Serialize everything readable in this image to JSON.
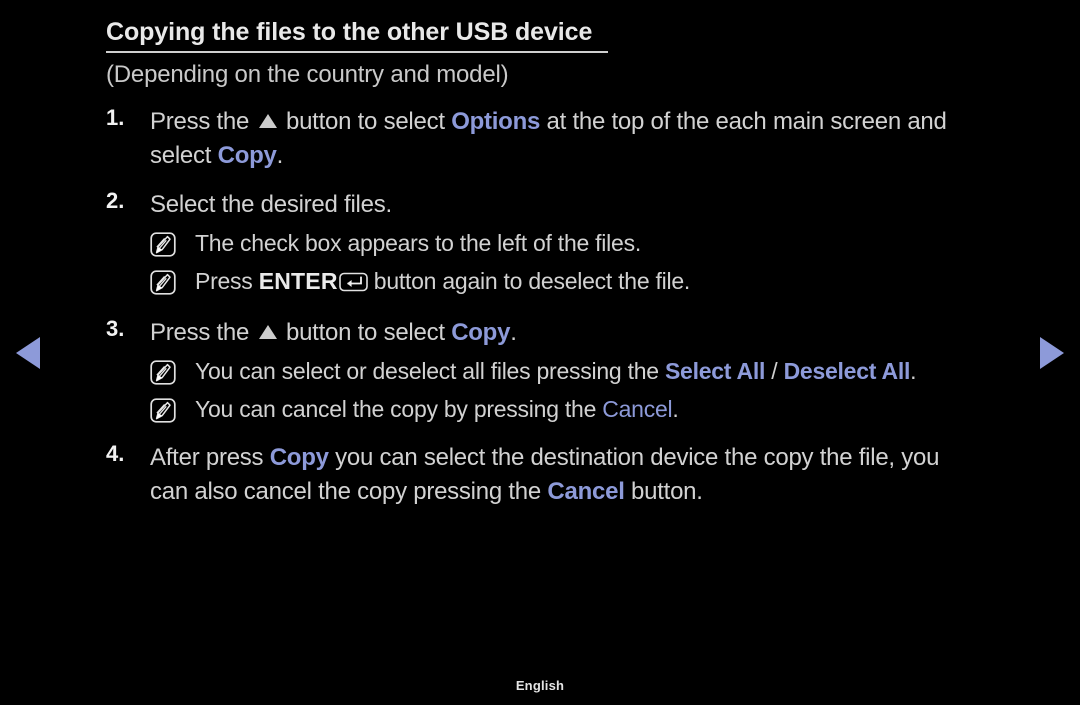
{
  "page": {
    "title": "Copying the files to the other USB device",
    "subtitle": "(Depending on the country and model)",
    "footer_language": "English",
    "accent_color": "#8d9ad9",
    "text_color": "#d2d2d2",
    "background_color": "#000000"
  },
  "nav": {
    "prev_icon": "triangle-left-icon",
    "next_icon": "triangle-right-icon"
  },
  "steps": [
    {
      "number": "1.",
      "line1_a": "Press the",
      "up_button_icon": "up-triangle-icon",
      "line1_b": "button to select",
      "line1_accent": "Options",
      "line1_c": "at the top of the each main screen and",
      "line2_a": "select",
      "line2_accent": "Copy",
      "line2_b": ".",
      "notes": []
    },
    {
      "number": "2.",
      "text": "Select the desired files.",
      "notes": [
        {
          "icon": "note-pen-icon",
          "text": "The check box appears to the left of the files."
        },
        {
          "icon": "note-pen-icon",
          "prefix": "Press",
          "key_label": "ENTER",
          "key_icon": "enter-return-icon",
          "suffix": "button again to deselect the file."
        }
      ]
    },
    {
      "number": "3.",
      "line1_a": "Press the",
      "up_button_icon": "up-triangle-icon",
      "line1_b": "button to select",
      "line1_accent": "Copy",
      "line1_c": ".",
      "notes": [
        {
          "icon": "note-pen-icon",
          "prefix": "You can select or deselect all files pressing the",
          "accent1": "Select All",
          "separator": "/",
          "accent2": "Deselect All",
          "suffix": "."
        },
        {
          "icon": "note-pen-icon",
          "prefix": "You can cancel the copy by pressing the",
          "accent1": "Cancel",
          "suffix": "."
        }
      ]
    },
    {
      "number": "4.",
      "line1_a": "After press",
      "line1_accent": "Copy",
      "line1_b": "you can select the destination device the copy the file, you",
      "line2_a": "can also cancel the copy pressing the",
      "line2_accent": "Cancel",
      "line2_b": "button."
    }
  ]
}
